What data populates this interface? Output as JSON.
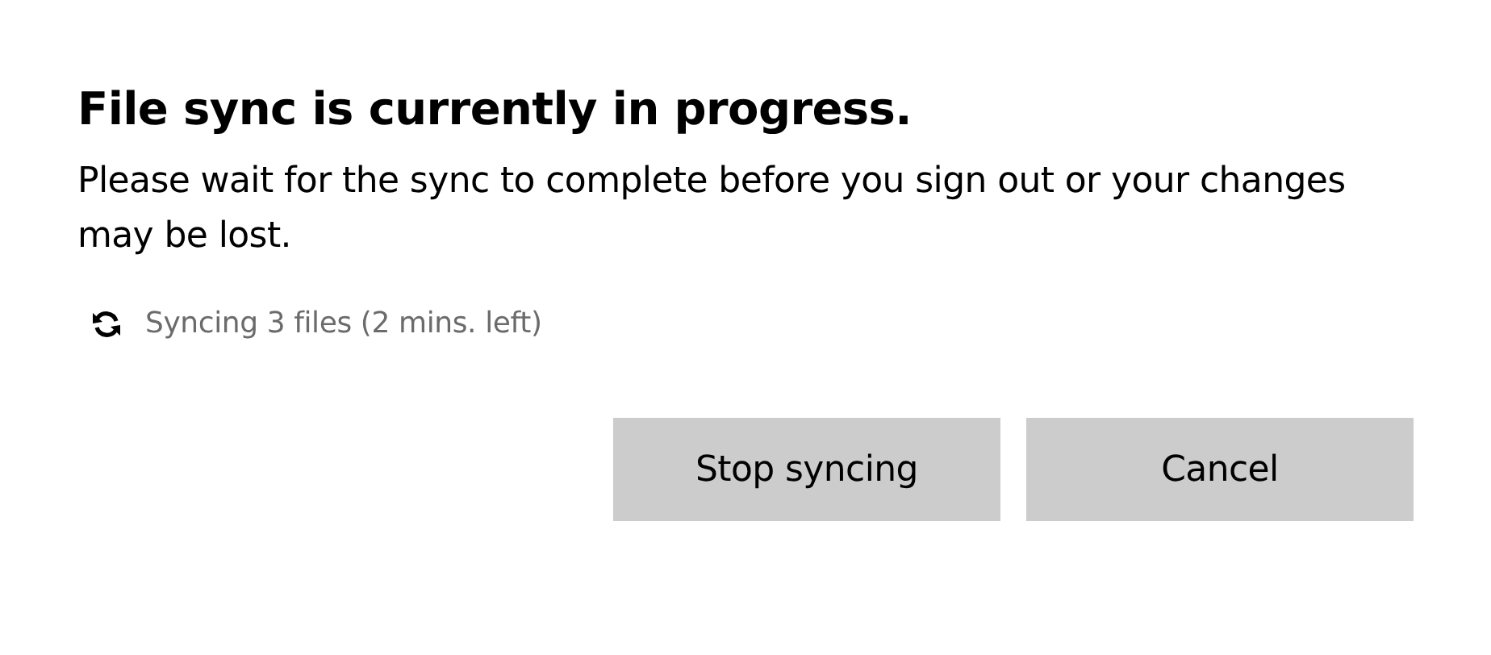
{
  "dialog": {
    "title": "File sync is currently in progress.",
    "message": "Please wait for the sync to complete before you sign out or your changes may be lost.",
    "status": "Syncing 3 files (2 mins. left)",
    "buttons": [
      "Stop syncing",
      "Cancel"
    ]
  }
}
